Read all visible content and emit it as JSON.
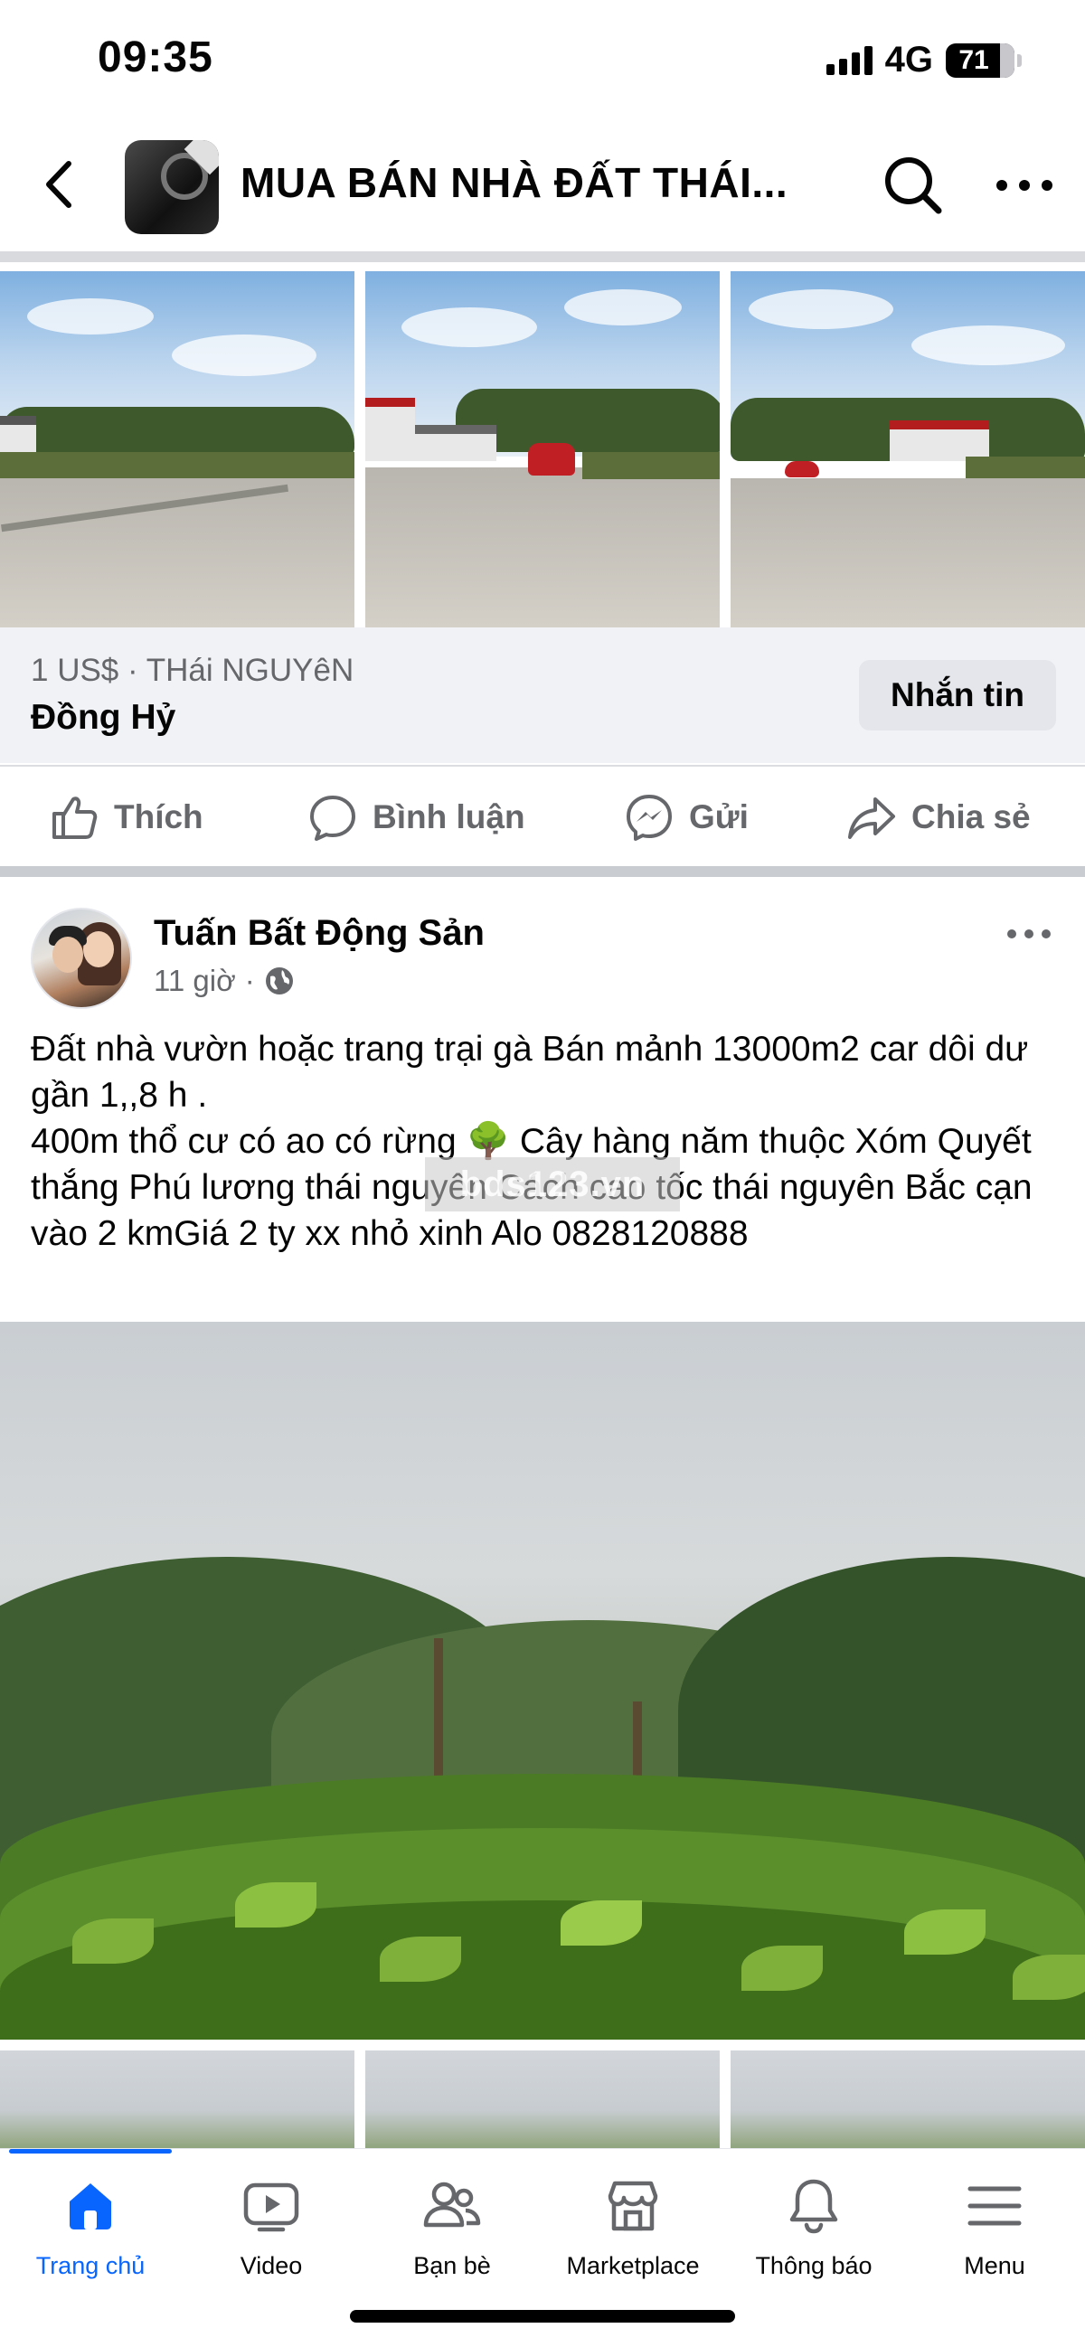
{
  "status_bar": {
    "time": "09:35",
    "network": "4G",
    "battery": "71"
  },
  "header": {
    "group_name": "MUA BÁN NHÀ ĐẤT THÁI..."
  },
  "listing": {
    "price_location": "1 US$ · THái NGUYêN",
    "location": "Đồng Hỷ",
    "message_button": "Nhắn tin"
  },
  "actions": {
    "like": "Thích",
    "comment": "Bình luận",
    "send": "Gửi",
    "share": "Chia sẻ"
  },
  "post": {
    "author": "Tuấn Bất Động Sản",
    "time": "11 giờ",
    "separator": "·",
    "text_line1": "Đất nhà vườn hoặc trang trại gà Bán mảnh 13000m2 car dôi dư gần 1,,8 h .",
    "text_line2": "400m thổ cư có ao có rừng 🌳 Cây hàng năm thuộc Xóm Quyết thắng Phú lương thái nguyên Cách cao tốc thái nguyên Bắc cạn vào 2 kmGiá 2 ty xx nhỏ xinh Alo 0828120888",
    "watermark": "bds123.vn"
  },
  "bottom_nav": [
    {
      "label": "Trang chủ",
      "icon": "home-icon",
      "active": true
    },
    {
      "label": "Video",
      "icon": "video-icon",
      "active": false
    },
    {
      "label": "Bạn bè",
      "icon": "friends-icon",
      "active": false
    },
    {
      "label": "Marketplace",
      "icon": "marketplace-icon",
      "active": false
    },
    {
      "label": "Thông báo",
      "icon": "bell-icon",
      "active": false
    },
    {
      "label": "Menu",
      "icon": "menu-icon",
      "active": false
    }
  ],
  "colors": {
    "accent": "#0866ff",
    "muted_text": "#65676b",
    "button_bg": "#e4e6eb",
    "card_bg": "#f0f2f5"
  }
}
